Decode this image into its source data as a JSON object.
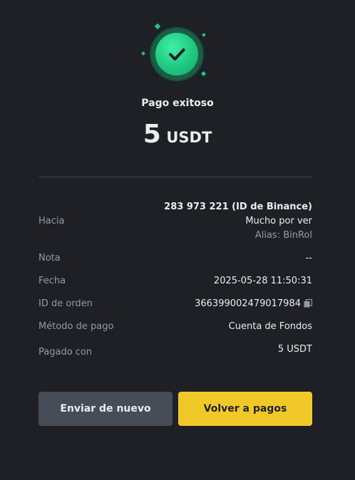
{
  "status": {
    "title": "Pago exitoso",
    "amount": "5",
    "unit": "USDT"
  },
  "details": {
    "to_label": "Hacia",
    "to_id": "283 973 221 (ID de Binance)",
    "to_name": "Mucho por ver",
    "to_alias": "Alias: BinRol",
    "note_label": "Nota",
    "note_value": "--",
    "date_label": "Fecha",
    "date_value": "2025-05-28 11:50:31",
    "order_label": "ID de orden",
    "order_value": "366399002479017984",
    "method_label": "Método de pago",
    "method_value": "Cuenta de Fondos",
    "paid_label": "Pagado con",
    "paid_value": "5 USDT"
  },
  "actions": {
    "resend_label": "Enviar de nuevo",
    "back_label": "Volver a pagos"
  },
  "colors": {
    "background": "#1e2026",
    "success": "#20c77f",
    "primary_button": "#f0c929",
    "secondary_button": "#474d57",
    "muted_text": "#929aa5"
  },
  "icons": {
    "success": "check-circle-icon",
    "copy": "copy-icon"
  }
}
